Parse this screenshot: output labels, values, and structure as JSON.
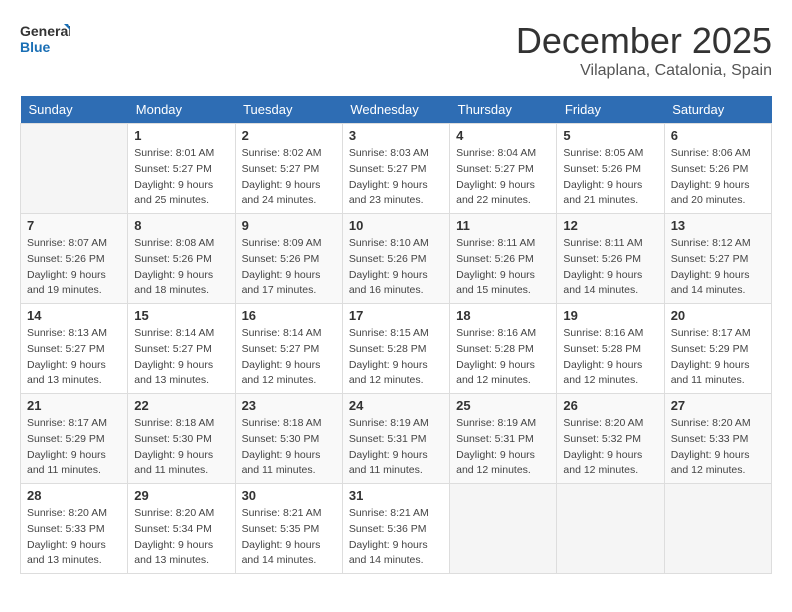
{
  "logo": {
    "line1": "General",
    "line2": "Blue"
  },
  "title": "December 2025",
  "subtitle": "Vilaplana, Catalonia, Spain",
  "weekdays": [
    "Sunday",
    "Monday",
    "Tuesday",
    "Wednesday",
    "Thursday",
    "Friday",
    "Saturday"
  ],
  "weeks": [
    [
      {
        "day": "",
        "sunrise": "",
        "sunset": "",
        "daylight": ""
      },
      {
        "day": "1",
        "sunrise": "Sunrise: 8:01 AM",
        "sunset": "Sunset: 5:27 PM",
        "daylight": "Daylight: 9 hours and 25 minutes."
      },
      {
        "day": "2",
        "sunrise": "Sunrise: 8:02 AM",
        "sunset": "Sunset: 5:27 PM",
        "daylight": "Daylight: 9 hours and 24 minutes."
      },
      {
        "day": "3",
        "sunrise": "Sunrise: 8:03 AM",
        "sunset": "Sunset: 5:27 PM",
        "daylight": "Daylight: 9 hours and 23 minutes."
      },
      {
        "day": "4",
        "sunrise": "Sunrise: 8:04 AM",
        "sunset": "Sunset: 5:27 PM",
        "daylight": "Daylight: 9 hours and 22 minutes."
      },
      {
        "day": "5",
        "sunrise": "Sunrise: 8:05 AM",
        "sunset": "Sunset: 5:26 PM",
        "daylight": "Daylight: 9 hours and 21 minutes."
      },
      {
        "day": "6",
        "sunrise": "Sunrise: 8:06 AM",
        "sunset": "Sunset: 5:26 PM",
        "daylight": "Daylight: 9 hours and 20 minutes."
      }
    ],
    [
      {
        "day": "7",
        "sunrise": "Sunrise: 8:07 AM",
        "sunset": "Sunset: 5:26 PM",
        "daylight": "Daylight: 9 hours and 19 minutes."
      },
      {
        "day": "8",
        "sunrise": "Sunrise: 8:08 AM",
        "sunset": "Sunset: 5:26 PM",
        "daylight": "Daylight: 9 hours and 18 minutes."
      },
      {
        "day": "9",
        "sunrise": "Sunrise: 8:09 AM",
        "sunset": "Sunset: 5:26 PM",
        "daylight": "Daylight: 9 hours and 17 minutes."
      },
      {
        "day": "10",
        "sunrise": "Sunrise: 8:10 AM",
        "sunset": "Sunset: 5:26 PM",
        "daylight": "Daylight: 9 hours and 16 minutes."
      },
      {
        "day": "11",
        "sunrise": "Sunrise: 8:11 AM",
        "sunset": "Sunset: 5:26 PM",
        "daylight": "Daylight: 9 hours and 15 minutes."
      },
      {
        "day": "12",
        "sunrise": "Sunrise: 8:11 AM",
        "sunset": "Sunset: 5:26 PM",
        "daylight": "Daylight: 9 hours and 14 minutes."
      },
      {
        "day": "13",
        "sunrise": "Sunrise: 8:12 AM",
        "sunset": "Sunset: 5:27 PM",
        "daylight": "Daylight: 9 hours and 14 minutes."
      }
    ],
    [
      {
        "day": "14",
        "sunrise": "Sunrise: 8:13 AM",
        "sunset": "Sunset: 5:27 PM",
        "daylight": "Daylight: 9 hours and 13 minutes."
      },
      {
        "day": "15",
        "sunrise": "Sunrise: 8:14 AM",
        "sunset": "Sunset: 5:27 PM",
        "daylight": "Daylight: 9 hours and 13 minutes."
      },
      {
        "day": "16",
        "sunrise": "Sunrise: 8:14 AM",
        "sunset": "Sunset: 5:27 PM",
        "daylight": "Daylight: 9 hours and 12 minutes."
      },
      {
        "day": "17",
        "sunrise": "Sunrise: 8:15 AM",
        "sunset": "Sunset: 5:28 PM",
        "daylight": "Daylight: 9 hours and 12 minutes."
      },
      {
        "day": "18",
        "sunrise": "Sunrise: 8:16 AM",
        "sunset": "Sunset: 5:28 PM",
        "daylight": "Daylight: 9 hours and 12 minutes."
      },
      {
        "day": "19",
        "sunrise": "Sunrise: 8:16 AM",
        "sunset": "Sunset: 5:28 PM",
        "daylight": "Daylight: 9 hours and 12 minutes."
      },
      {
        "day": "20",
        "sunrise": "Sunrise: 8:17 AM",
        "sunset": "Sunset: 5:29 PM",
        "daylight": "Daylight: 9 hours and 11 minutes."
      }
    ],
    [
      {
        "day": "21",
        "sunrise": "Sunrise: 8:17 AM",
        "sunset": "Sunset: 5:29 PM",
        "daylight": "Daylight: 9 hours and 11 minutes."
      },
      {
        "day": "22",
        "sunrise": "Sunrise: 8:18 AM",
        "sunset": "Sunset: 5:30 PM",
        "daylight": "Daylight: 9 hours and 11 minutes."
      },
      {
        "day": "23",
        "sunrise": "Sunrise: 8:18 AM",
        "sunset": "Sunset: 5:30 PM",
        "daylight": "Daylight: 9 hours and 11 minutes."
      },
      {
        "day": "24",
        "sunrise": "Sunrise: 8:19 AM",
        "sunset": "Sunset: 5:31 PM",
        "daylight": "Daylight: 9 hours and 11 minutes."
      },
      {
        "day": "25",
        "sunrise": "Sunrise: 8:19 AM",
        "sunset": "Sunset: 5:31 PM",
        "daylight": "Daylight: 9 hours and 12 minutes."
      },
      {
        "day": "26",
        "sunrise": "Sunrise: 8:20 AM",
        "sunset": "Sunset: 5:32 PM",
        "daylight": "Daylight: 9 hours and 12 minutes."
      },
      {
        "day": "27",
        "sunrise": "Sunrise: 8:20 AM",
        "sunset": "Sunset: 5:33 PM",
        "daylight": "Daylight: 9 hours and 12 minutes."
      }
    ],
    [
      {
        "day": "28",
        "sunrise": "Sunrise: 8:20 AM",
        "sunset": "Sunset: 5:33 PM",
        "daylight": "Daylight: 9 hours and 13 minutes."
      },
      {
        "day": "29",
        "sunrise": "Sunrise: 8:20 AM",
        "sunset": "Sunset: 5:34 PM",
        "daylight": "Daylight: 9 hours and 13 minutes."
      },
      {
        "day": "30",
        "sunrise": "Sunrise: 8:21 AM",
        "sunset": "Sunset: 5:35 PM",
        "daylight": "Daylight: 9 hours and 14 minutes."
      },
      {
        "day": "31",
        "sunrise": "Sunrise: 8:21 AM",
        "sunset": "Sunset: 5:36 PM",
        "daylight": "Daylight: 9 hours and 14 minutes."
      },
      {
        "day": "",
        "sunrise": "",
        "sunset": "",
        "daylight": ""
      },
      {
        "day": "",
        "sunrise": "",
        "sunset": "",
        "daylight": ""
      },
      {
        "day": "",
        "sunrise": "",
        "sunset": "",
        "daylight": ""
      }
    ]
  ]
}
